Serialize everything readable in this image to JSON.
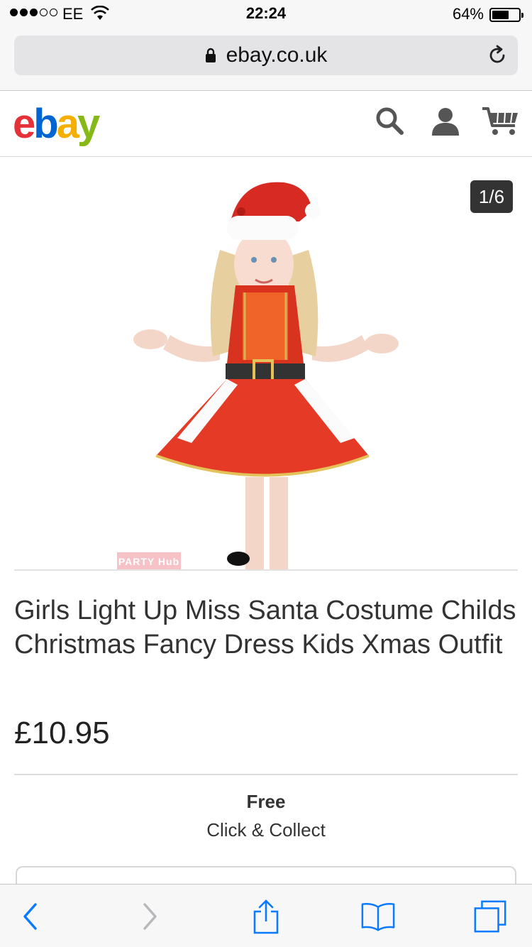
{
  "status_bar": {
    "carrier": "EE",
    "time": "22:24",
    "battery_percent_label": "64%",
    "battery_level": 0.64,
    "signal_bars_filled": 3,
    "signal_bars_total": 5
  },
  "browser": {
    "url": "ebay.co.uk"
  },
  "site": {
    "logo_letters": [
      "e",
      "b",
      "a",
      "y"
    ]
  },
  "gallery": {
    "counter": "1/6",
    "watermark": "PARTY Hub"
  },
  "listing": {
    "title": "Girls Light Up Miss Santa Costume Childs Christmas Fancy Dress Kids Xmas Outfit",
    "price": "£10.95",
    "shipping_cost": "Free",
    "shipping_method": "Click & Collect"
  },
  "colors": {
    "ebay_red": "#e53238",
    "ebay_blue": "#0064d2",
    "ebay_yellow": "#f5af02",
    "ebay_green": "#86b817",
    "ios_blue": "#0a7aff"
  },
  "icons": {
    "search": "search-icon",
    "account": "user-icon",
    "cart": "cart-icon",
    "back": "chevron-left-icon",
    "forward": "chevron-right-icon",
    "share": "share-icon",
    "bookmarks": "book-icon",
    "tabs": "tabs-icon",
    "reload": "reload-icon",
    "lock": "lock-icon"
  }
}
